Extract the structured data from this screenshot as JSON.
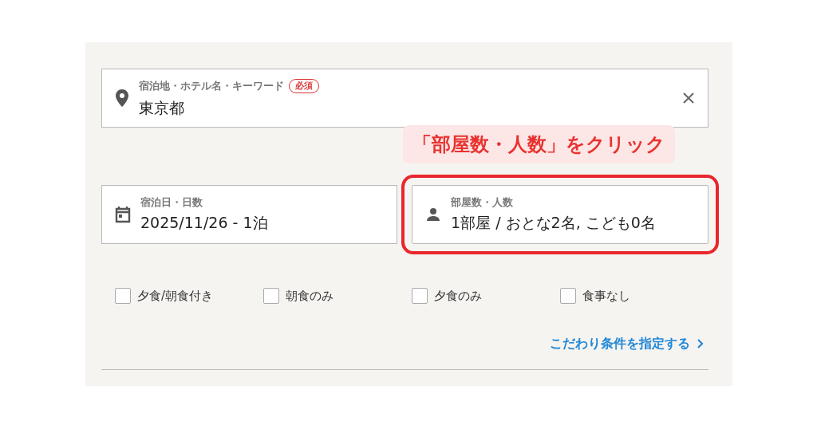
{
  "keyword_field": {
    "label": "宿泊地・ホテル名・キーワード",
    "required_badge": "必須",
    "value": "東京都"
  },
  "callout": {
    "text": "「部屋数・人数」をクリック"
  },
  "date_field": {
    "label": "宿泊日・日数",
    "value": "2025/11/26 - 1泊",
    "highlighted": false
  },
  "guests_field": {
    "label": "部屋数・人数",
    "value": "1部屋 / おとな2名, こども0名",
    "highlighted": true
  },
  "meal_options": [
    {
      "label": "夕食/朝食付き",
      "checked": false
    },
    {
      "label": "朝食のみ",
      "checked": false
    },
    {
      "label": "夕食のみ",
      "checked": false
    },
    {
      "label": "食事なし",
      "checked": false
    }
  ],
  "more_conditions_link": {
    "label": "こだわり条件を指定する"
  }
}
